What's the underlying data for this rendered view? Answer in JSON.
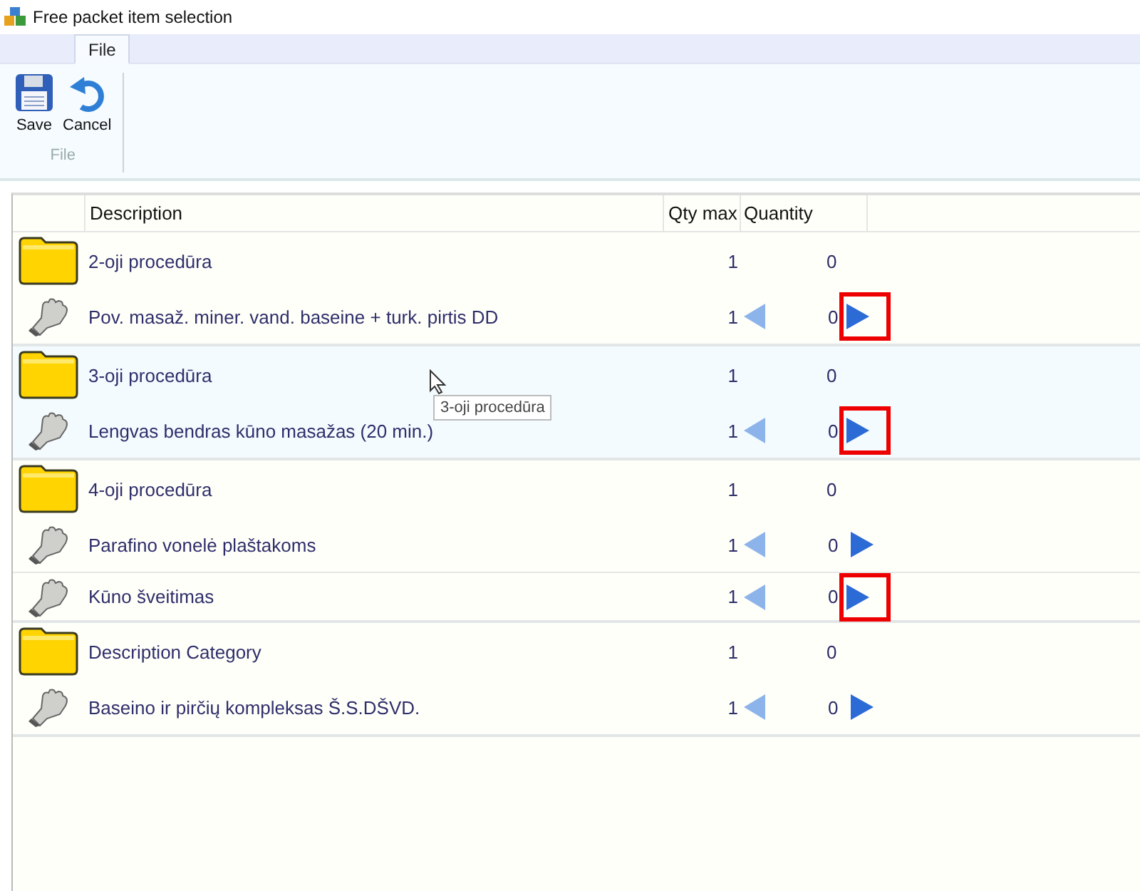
{
  "window": {
    "title": "Free packet item selection"
  },
  "tabs": [
    {
      "label": "File",
      "selected": true
    }
  ],
  "ribbon": {
    "buttons": [
      {
        "label": "Save",
        "kind": "save"
      },
      {
        "label": "Cancel",
        "kind": "cancel"
      }
    ],
    "group_label": "File"
  },
  "table": {
    "columns": [
      "Description",
      "Qty max",
      "Quantity"
    ],
    "groups": [
      {
        "name": "2-oji procedūra",
        "qty_max": "1",
        "quantity": "0",
        "hovered": false,
        "items": [
          {
            "name": "Pov. masaž. miner. vand. baseine + turk. pirtis DD",
            "qty_max": "1",
            "quantity": "0",
            "marked": true
          }
        ]
      },
      {
        "name": "3-oji procedūra",
        "qty_max": "1",
        "quantity": "0",
        "hovered": true,
        "tooltip": "3-oji procedūra",
        "items": [
          {
            "name": "Lengvas bendras kūno masažas (20 min.)",
            "qty_max": "1",
            "quantity": "0",
            "marked": true
          }
        ]
      },
      {
        "name": "4-oji procedūra",
        "qty_max": "1",
        "quantity": "0",
        "hovered": false,
        "items": [
          {
            "name": "Parafino vonelė plaštakoms",
            "qty_max": "1",
            "quantity": "0",
            "marked": false
          },
          {
            "name": "Kūno šveitimas",
            "qty_max": "1",
            "quantity": "0",
            "marked": true
          }
        ]
      },
      {
        "name": "Description Category",
        "qty_max": "1",
        "quantity": "0",
        "hovered": false,
        "items": [
          {
            "name": "Baseino ir pirčių kompleksas Š.S.DŠVD.",
            "qty_max": "1",
            "quantity": "0",
            "marked": false
          }
        ]
      }
    ]
  }
}
